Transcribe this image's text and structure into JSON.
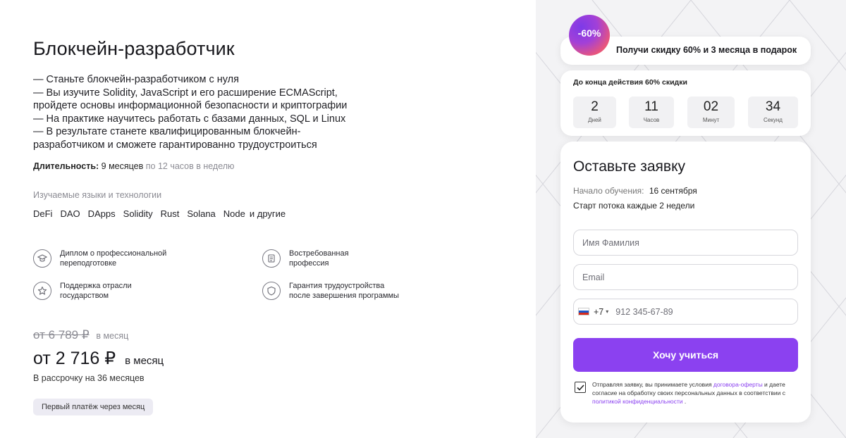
{
  "course": {
    "title": "Блокчейн-разработчик",
    "description": [
      "— Станьте блокчейн-разработчиком с нуля",
      "— Вы изучите Solidity, JavaScript и его расширение ECMAScript,",
      "пройдете основы информационной безопасности и криптографии",
      "— На практике научитесь работать с базами данных, SQL и Linux",
      "— В результате станете квалифицированным блокчейн-",
      "разработчиком и сможете гарантированно трудоустроиться"
    ],
    "duration_label": "Длительность:",
    "duration_value": "9 месяцев",
    "duration_hours": "по 12 часов в неделю",
    "tech_label": "Изучаемые языки и технологии",
    "tech": [
      "DeFi",
      "DAO",
      "DApps",
      "Solidity",
      "Rust",
      "Solana",
      "Node",
      "и другие"
    ]
  },
  "features": [
    {
      "icon": "graduation-cap-icon",
      "line1": "Диплом о профессиональной",
      "line2": "переподготовке"
    },
    {
      "icon": "document-list-icon",
      "line1": "Востребованная",
      "line2": "профессия"
    },
    {
      "icon": "star-icon",
      "line1": "Поддержка отрасли",
      "line2": "государством"
    },
    {
      "icon": "shield-icon",
      "line1": "Гарантия трудоустройства",
      "line2": "после завершения программы"
    }
  ],
  "pricing": {
    "old_price": "от 6 789 ₽",
    "old_unit": "в месяц",
    "new_price": "от 2 716 ₽",
    "new_unit": "в месяц",
    "installment": "В рассрочку на 36 месяцев",
    "first_payment": "Первый платёж через месяц"
  },
  "promo": {
    "badge": "-60%",
    "text": "Получи скидку 60% и 3 месяца в подарок",
    "timer_label": "До конца действия 60% скидки",
    "timer": [
      {
        "value": "2",
        "label": "Дней"
      },
      {
        "value": "11",
        "label": "Часов"
      },
      {
        "value": "02",
        "label": "Минут"
      },
      {
        "value": "34",
        "label": "Секунд"
      }
    ]
  },
  "form": {
    "title": "Оставьте заявку",
    "start_label": "Начало обучения:",
    "start_value": "16 сентября",
    "stream": "Старт потока каждые 2 недели",
    "name_placeholder": "Имя Фамилия",
    "email_placeholder": "Email",
    "phone_code": "+7",
    "phone_placeholder": "912 345-67-89",
    "submit": "Хочу учиться",
    "consent_part1": "Отправляя заявку, вы принимаете условия ",
    "consent_link1": "договора-оферты",
    "consent_part2": " и даете согласие на обработку своих персональных данных в соответствии с ",
    "consent_link2": "политикой конфиденциальности",
    "consent_part3": " .",
    "accent_color": "#8b41f0"
  }
}
